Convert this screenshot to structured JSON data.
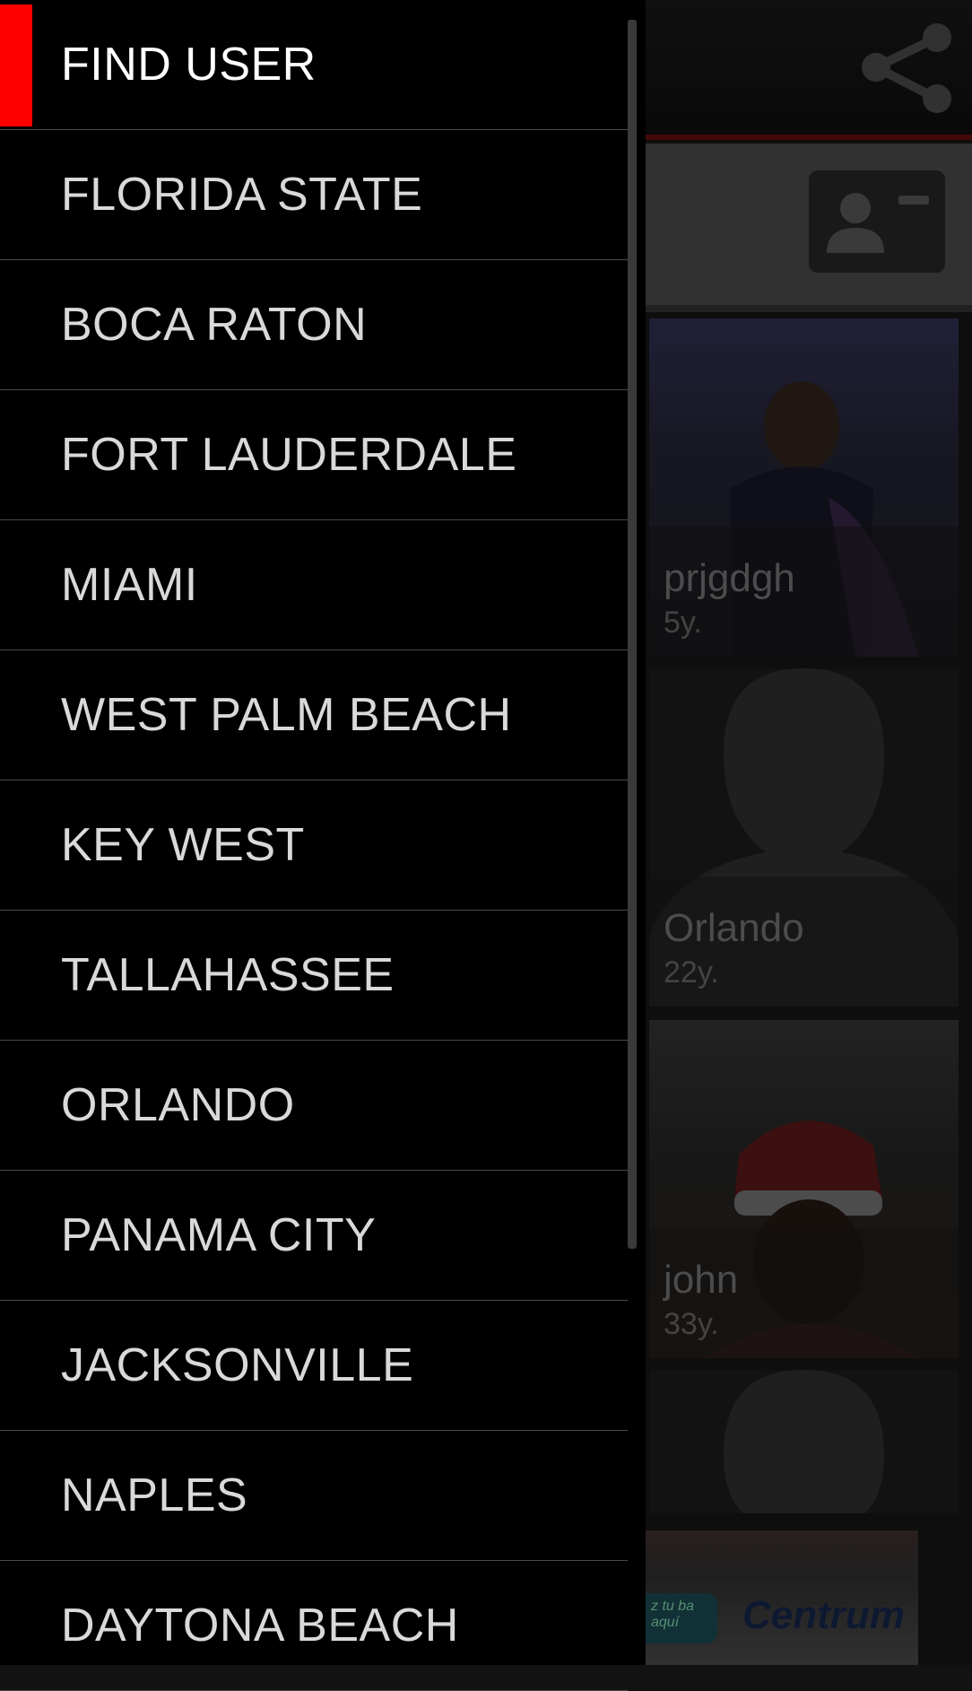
{
  "drawer": {
    "items": [
      {
        "label": "FIND USER",
        "active": true
      },
      {
        "label": "FLORIDA STATE"
      },
      {
        "label": "BOCA RATON"
      },
      {
        "label": "FORT LAUDERDALE"
      },
      {
        "label": "MIAMI"
      },
      {
        "label": "WEST PALM BEACH"
      },
      {
        "label": "KEY WEST"
      },
      {
        "label": "TALLAHASSEE"
      },
      {
        "label": "ORLANDO"
      },
      {
        "label": "PANAMA CITY"
      },
      {
        "label": "JACKSONVILLE"
      },
      {
        "label": "NAPLES"
      },
      {
        "label": "DAYTONA BEACH"
      }
    ],
    "active_color": "#ff0000"
  },
  "header": {
    "share_icon": "share-icon",
    "accent_color": "#7a1010"
  },
  "filter": {
    "contact_card_icon": "contact-card-icon"
  },
  "users": [
    {
      "name": "prjgdgh",
      "age": "5y."
    },
    {
      "name": "Orlando",
      "age": "22y."
    },
    {
      "name": "john",
      "age": "33y."
    }
  ],
  "ad": {
    "pill_text": "z tu\nba aquí",
    "brand": "Centrum"
  }
}
